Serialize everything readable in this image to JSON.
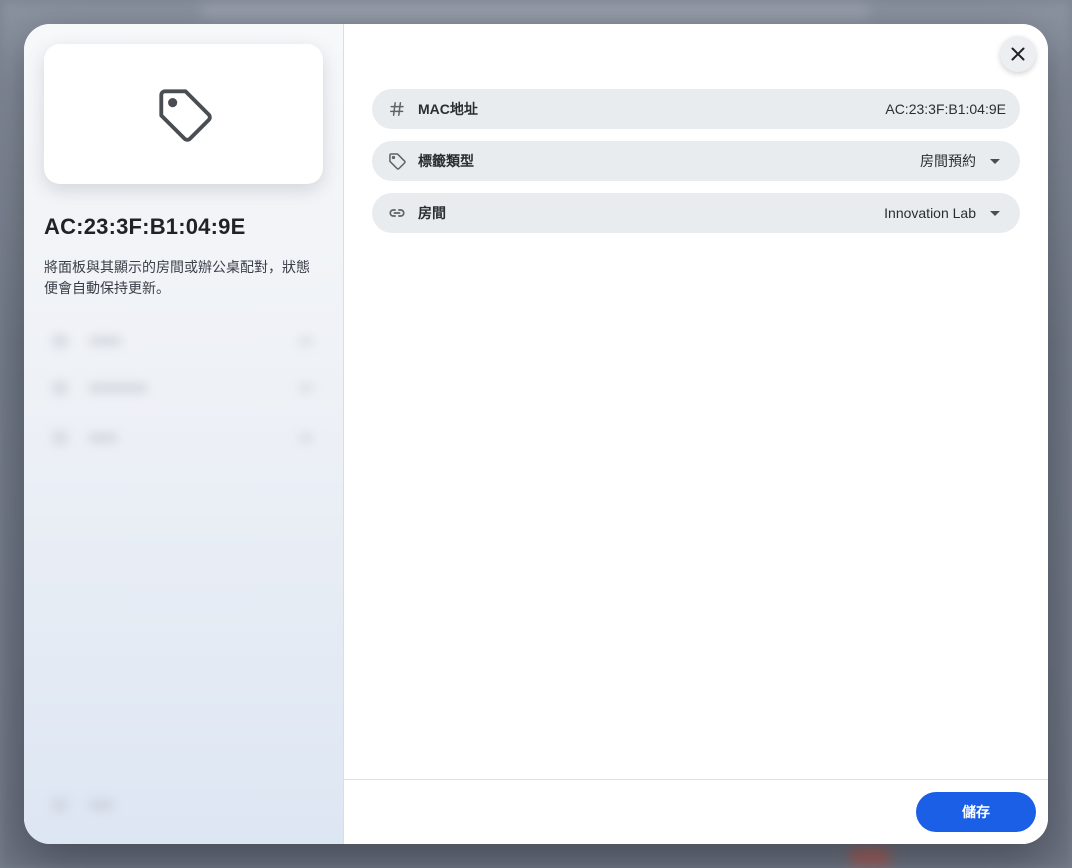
{
  "dialog": {
    "close_label": "Close",
    "footer": {
      "save_label": "儲存"
    }
  },
  "left": {
    "preview_icon": "tag-icon",
    "title": "AC:23:3F:B1:04:9E",
    "description": "將面板與其顯示的房間或辦公桌配對，狀態便會自動保持更新。"
  },
  "fields": [
    {
      "icon": "hash-icon",
      "label": "MAC地址",
      "value": "AC:23:3F:B1:04:9E",
      "type": "readonly"
    },
    {
      "icon": "tag-icon",
      "label": "標籤類型",
      "value": "房間預約",
      "type": "select"
    },
    {
      "icon": "link-icon",
      "label": "房間",
      "value": "Innovation Lab",
      "type": "select"
    }
  ],
  "colors": {
    "accent": "#1a5fe6",
    "field_bg": "#e9ecef"
  }
}
